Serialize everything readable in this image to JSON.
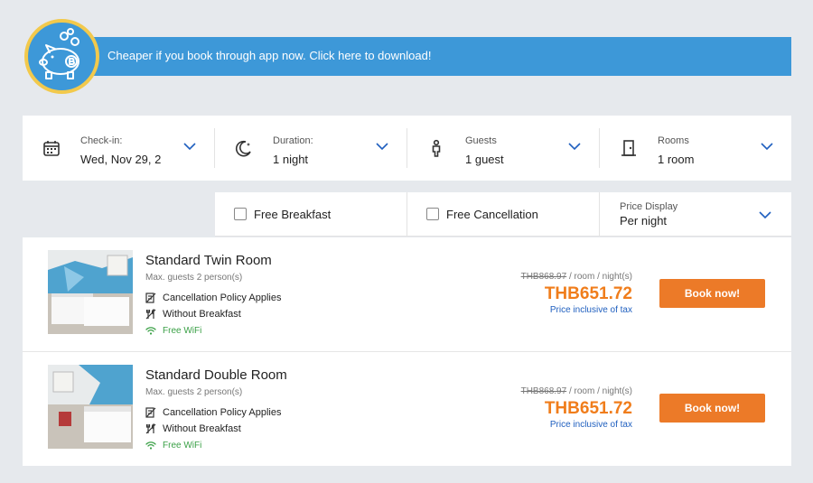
{
  "promo": {
    "text": "Cheaper if you book through app now. Click here to download!"
  },
  "search": {
    "checkin": {
      "label": "Check-in:",
      "value": "Wed, Nov 29, 2"
    },
    "duration": {
      "label": "Duration:",
      "value": "1 night"
    },
    "guests": {
      "label": "Guests",
      "value": "1 guest"
    },
    "rooms": {
      "label": "Rooms",
      "value": "1 room"
    }
  },
  "filters": {
    "free_breakfast": "Free Breakfast",
    "free_cancellation": "Free Cancellation",
    "price_display": {
      "label": "Price Display",
      "value": "Per night"
    }
  },
  "rooms": [
    {
      "name": "Standard Twin Room",
      "max_guests": "Max. guests 2 person(s)",
      "features": [
        "Cancellation Policy Applies",
        "Without Breakfast",
        "Free WiFi"
      ],
      "old_price": "THB868.97",
      "unit": " / room / night(s)",
      "price": "THB651.72",
      "tax_note": "Price inclusive of tax",
      "book_label": "Book now!"
    },
    {
      "name": "Standard Double Room",
      "max_guests": "Max. guests 2 person(s)",
      "features": [
        "Cancellation Policy Applies",
        "Without Breakfast",
        "Free WiFi"
      ],
      "old_price": "THB868.97",
      "unit": " / room / night(s)",
      "price": "THB651.72",
      "tax_note": "Price inclusive of tax",
      "book_label": "Book now!"
    }
  ],
  "colors": {
    "accent_blue": "#3d98d8",
    "price_orange": "#f07d1b",
    "button_orange": "#ec7a28",
    "wifi_green": "#3aa046",
    "tax_blue": "#1f5fbf"
  }
}
